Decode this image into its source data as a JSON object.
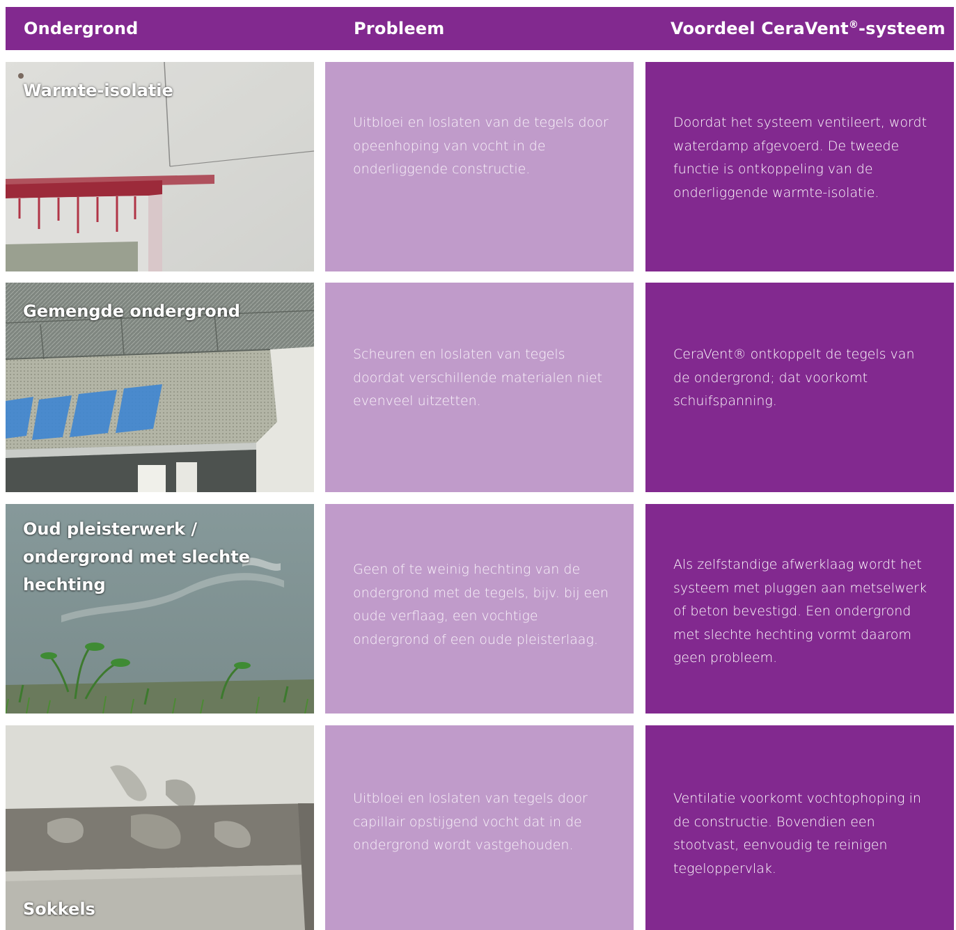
{
  "header": {
    "col1": "Ondergrond",
    "col2": "Probleem",
    "col3_prefix": "Voordeel CeraVent",
    "col3_reg": "®",
    "col3_suffix": "-systeem"
  },
  "colors": {
    "header_bg": "#82298f",
    "problem_bg": "#c09bca",
    "advantage_bg": "#82298f",
    "text": "#ffffff"
  },
  "rows": [
    {
      "label": "Warmte-isolatie",
      "problem": "Uitbloei en loslaten van de tegels door opeenhoping van vocht in de onderliggende constructie.",
      "advantage": "Doordat het systeem ventileert, wordt waterdamp afgevoerd. De tweede functie is ontkoppeling van de onderliggende warmte-isolatie."
    },
    {
      "label": "Gemengde ondergrond",
      "problem": "Scheuren en loslaten van tegels doordat verschillende materialen niet evenveel uitzetten.",
      "advantage": "CeraVent® ontkoppelt de tegels van de ondergrond; dat voorkomt schuifspanning."
    },
    {
      "label": "Oud pleisterwerk / ondergrond met slechte hechting",
      "problem": "Geen of te weinig hechting van de ondergrond met de tegels, bijv. bij een oude verflaag, een vochtige ondergrond of een oude pleisterlaag.",
      "advantage": "Als zelfstandige afwerklaag wordt het systeem met pluggen aan metselwerk of beton bevestigd. Een ondergrond met slechte hechting vormt daarom geen probleem."
    },
    {
      "label": "Sokkels",
      "problem": "Uitbloei en loslaten van tegels door capillair opstijgend vocht dat in de ondergrond wordt vastgehouden.",
      "advantage": "Ventilatie voorkomt vochtophoping in de constructie. Bovendien een stootvast, eenvoudig te reinigen tegeloppervlak."
    }
  ]
}
